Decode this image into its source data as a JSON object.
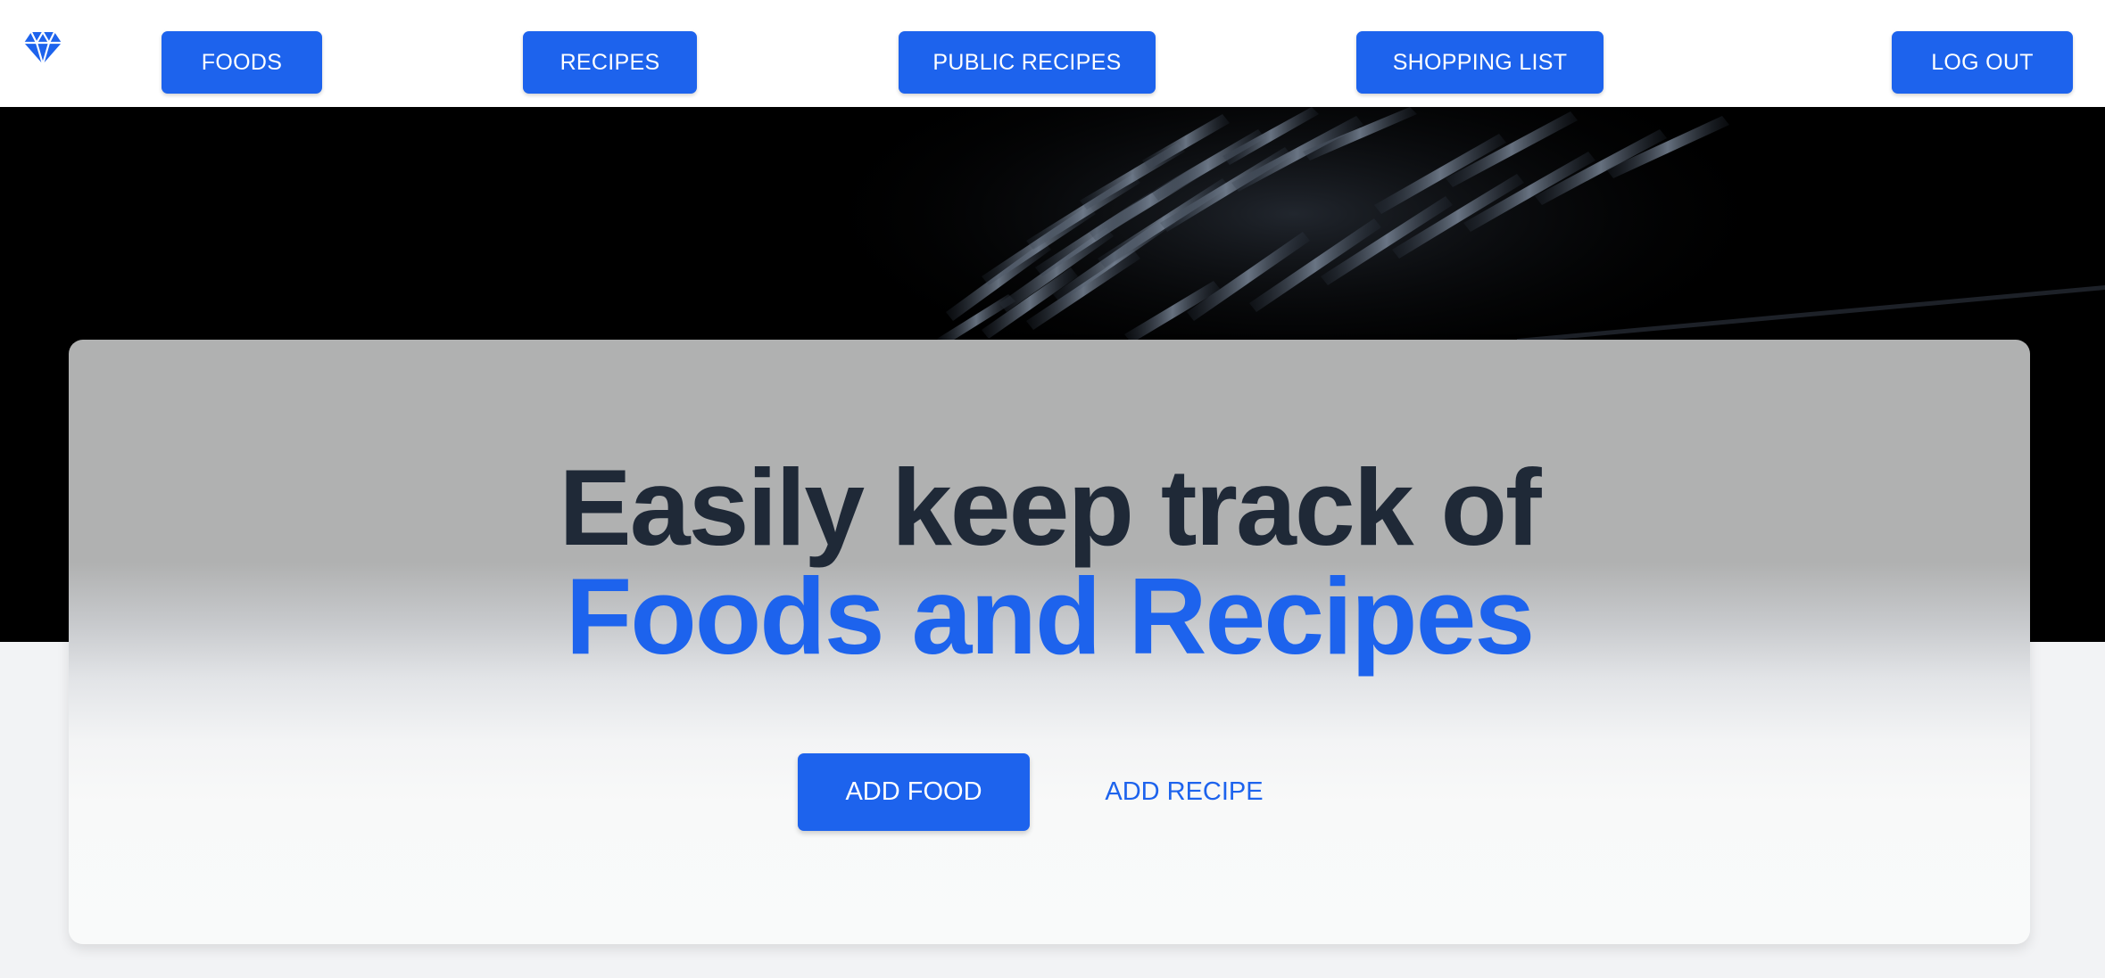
{
  "nav": {
    "logo_icon": "diamond-icon",
    "items": [
      {
        "label": "FOODS"
      },
      {
        "label": "RECIPES"
      },
      {
        "label": "PUBLIC RECIPES"
      },
      {
        "label": "SHOPPING LIST"
      }
    ],
    "logout_label": "LOG OUT"
  },
  "hero": {
    "headline_line1": "Easily keep track of",
    "headline_line2": "Foods and Recipes",
    "primary_cta": "ADD FOOD",
    "secondary_cta": "ADD RECIPE"
  },
  "colors": {
    "accent": "#1d63ed",
    "headline_dark": "#1f2937",
    "hero_background": "#000000",
    "page_background": "#f2f3f5"
  }
}
